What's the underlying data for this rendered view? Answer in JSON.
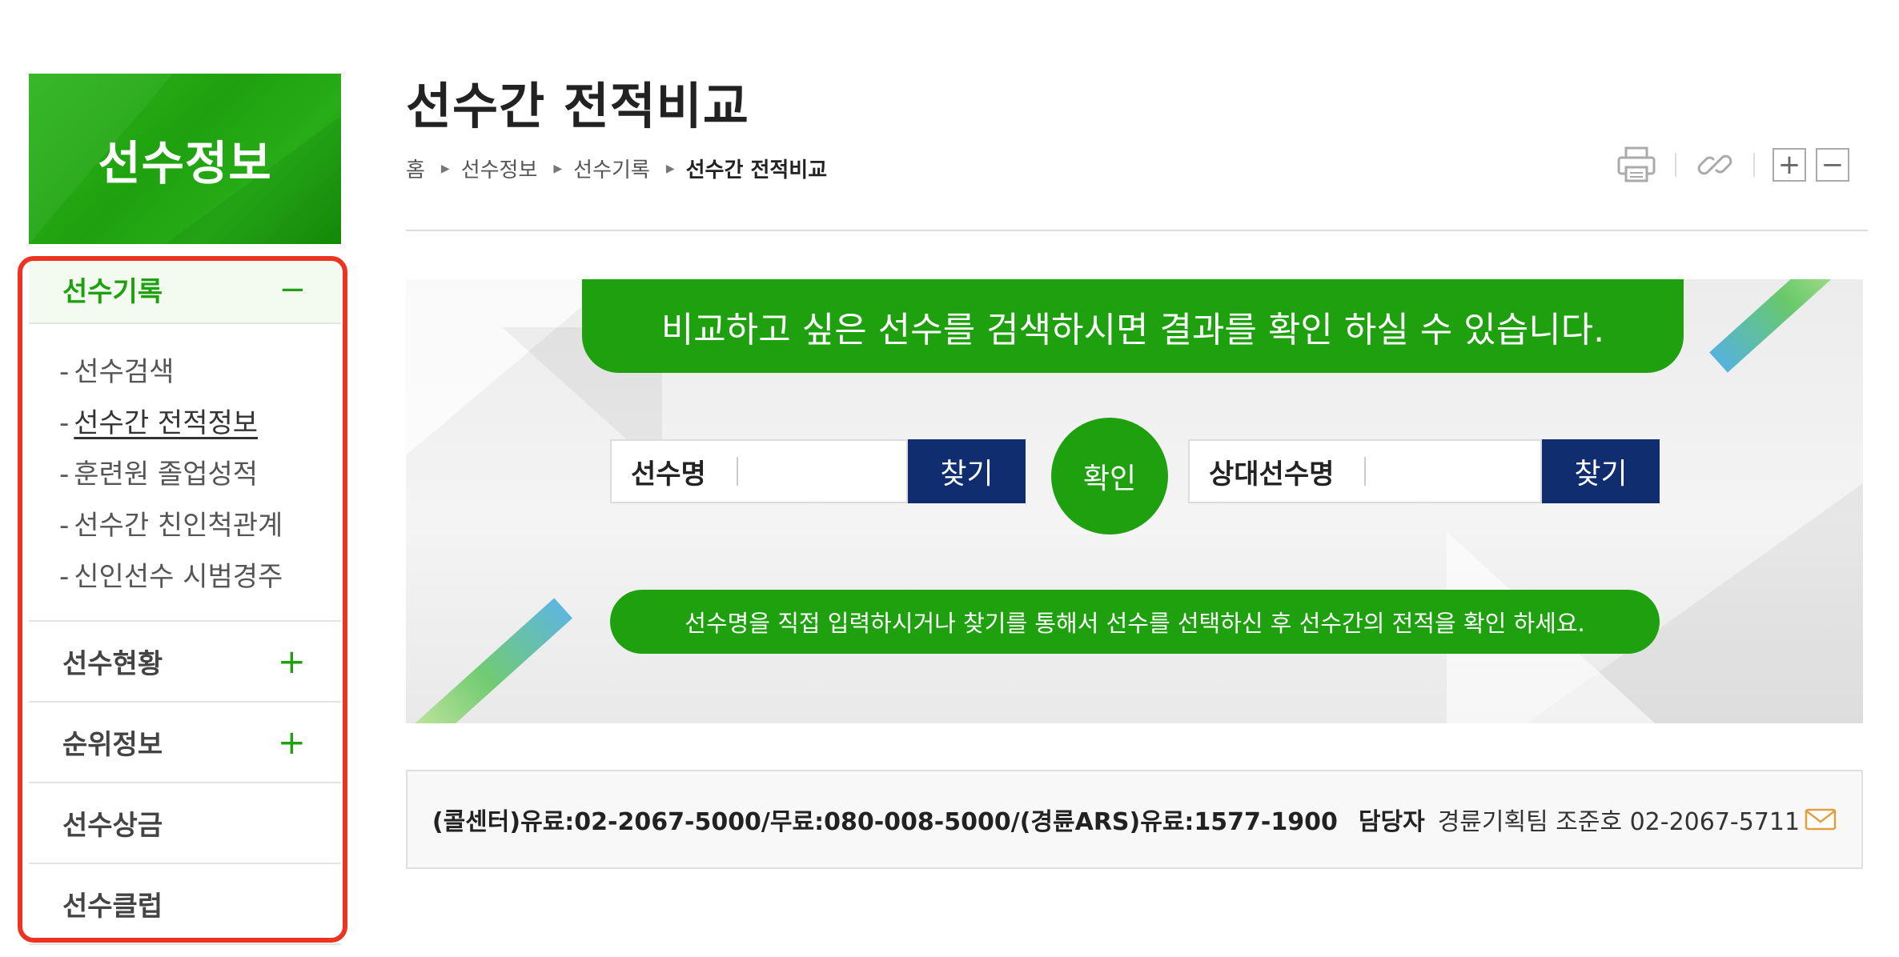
{
  "sidebar": {
    "title": "선수정보",
    "active_group": {
      "label": "선수기록",
      "toggle": "−"
    },
    "sub_items": [
      {
        "dash": "-",
        "label": "선수검색"
      },
      {
        "dash": "-",
        "label": "선수간 전적정보"
      },
      {
        "dash": "-",
        "label": "훈련원 졸업성적"
      },
      {
        "dash": "-",
        "label": "선수간 친인척관계"
      },
      {
        "dash": "-",
        "label": "신인선수 시범경주"
      }
    ],
    "groups": [
      {
        "label": "선수현황",
        "toggle": "+"
      },
      {
        "label": "순위정보",
        "toggle": "+"
      },
      {
        "label": "선수상금",
        "toggle": ""
      },
      {
        "label": "선수클럽",
        "toggle": ""
      }
    ]
  },
  "page": {
    "title": "선수간 전적비교",
    "breadcrumb": [
      "홈",
      "선수정보",
      "선수기록",
      "선수간 전적비교"
    ],
    "tools": {
      "print_icon": "printer-icon",
      "link_icon": "link-icon",
      "zoom_in": "+",
      "zoom_out": "−"
    }
  },
  "search": {
    "message": "비교하고 싶은 선수를 검색하시면 결과를 확인 하실 수 있습니다.",
    "player_label": "선수명",
    "player_value": "",
    "find_label": "찾기",
    "confirm_label": "확인",
    "opponent_label": "상대선수명",
    "opponent_value": "",
    "find_label_2": "찾기",
    "hint": "선수명을 직접 입력하시거나 찾기를 통해서 선수를 선택하신 후 선수간의 전적을 확인 하세요."
  },
  "contact": {
    "phones": "(콜센터)유료:02-2067-5000/무료:080-008-5000/(경륜ARS)유료:1577-1900",
    "manager_label": "담당자",
    "manager_value": "경륜기획팀 조준호 02-2067-5711"
  },
  "colors": {
    "brand_green": "#1fa10f",
    "navy_button": "#0f2d6f",
    "highlight_red": "#ee3322"
  }
}
